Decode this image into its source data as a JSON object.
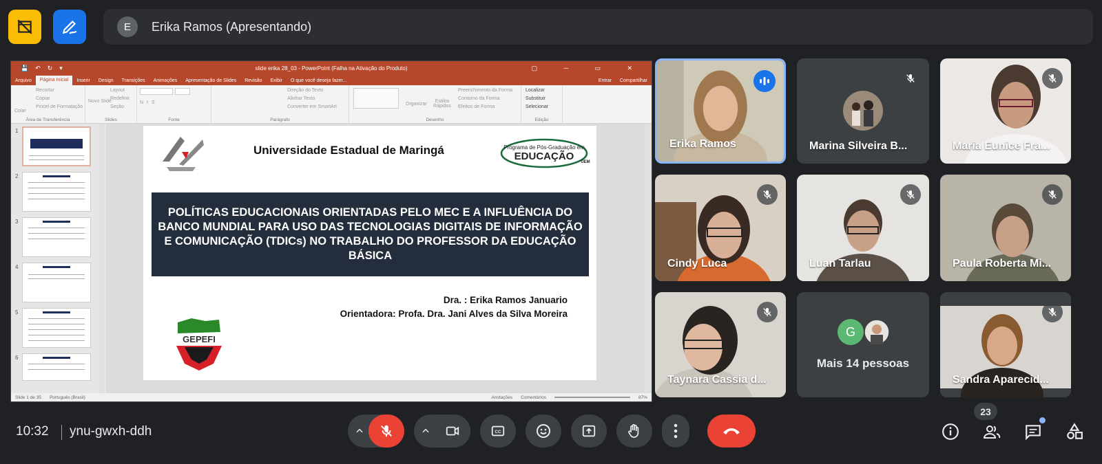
{
  "presenter": {
    "initial": "E",
    "label": "Erika Ramos (Apresentando)"
  },
  "ppt": {
    "window_title": "slide erika 28_03 - PowerPoint (Falha na Ativação do Produto)",
    "tabs": [
      "Arquivo",
      "Página Inicial",
      "Inserir",
      "Design",
      "Transições",
      "Animações",
      "Apresentação de Slides",
      "Revisão",
      "Exibir",
      "O que você deseja fazer..."
    ],
    "tabs_right": [
      "Entrar",
      "Compartilhar"
    ],
    "ribbon": {
      "clipboard": [
        "Recortar",
        "Copiar",
        "Pincel de Formatação",
        "Colar",
        "Área de Transferência"
      ],
      "slides": [
        "Layout",
        "Redefinir",
        "Seção",
        "Novo Slide",
        "Slides"
      ],
      "font_label": "Fonte",
      "paragraph": [
        "Direção do Texto",
        "Alinhar Texto",
        "Converter em SmartArt",
        "Parágrafo"
      ],
      "drawing": [
        "Organizar",
        "Estilos Rápidos",
        "Preenchimento da Forma",
        "Contorno da Forma",
        "Efeitos de Forma",
        "Desenho"
      ],
      "editing": [
        "Localizar",
        "Substituir",
        "Selecionar",
        "Edição"
      ]
    },
    "slide_numbers": [
      "1",
      "2",
      "3",
      "4",
      "5",
      "6"
    ],
    "slide": {
      "university": "Universidade Estadual de Maringá",
      "program_small": "Programa de Pós-Graduação em",
      "program_big": "EDUCAÇÃO",
      "program_tag": "UEM",
      "title": "POLÍTICAS EDUCACIONAIS ORIENTADAS PELO MEC E A INFLUÊNCIA DO BANCO MUNDIAL PARA USO DAS TECNOLOGIAS DIGITAIS DE INFORMAÇÃO E COMUNICAÇÃO (TDICs) NO TRABALHO DO PROFESSOR DA EDUCAÇÃO BÁSICA",
      "author": "Dra. : Erika Ramos Januario",
      "advisor": "Orientadora: Profa. Dra. Jani Alves da Silva Moreira",
      "gepefi": "GEPEFI"
    },
    "status": {
      "slide_count": "Slide 1 de 35",
      "language": "Português (Brasil)",
      "notes": "Anotações",
      "comments": "Comentários",
      "zoom": "87%"
    }
  },
  "participants": [
    {
      "name": "Erika Ramos",
      "state": "speaking"
    },
    {
      "name": "Marina Silveira B...",
      "state": "muted"
    },
    {
      "name": "Maria Eunice Fra...",
      "state": "muted"
    },
    {
      "name": "Cindy Luca",
      "state": "muted"
    },
    {
      "name": "Luan Tarlau",
      "state": "muted"
    },
    {
      "name": "Paula Roberta Mi...",
      "state": "muted"
    },
    {
      "name": "Taynara Cassia d...",
      "state": "muted"
    },
    {
      "name": "Mais 14 pessoas",
      "initial": "G"
    },
    {
      "name": "Sandra Aparecid...",
      "state": "muted"
    }
  ],
  "meeting": {
    "time": "10:32",
    "code": "ynu-gwxh-ddh",
    "participant_count": "23"
  },
  "colors": {
    "leave": "#ea4335",
    "accent": "#8ab4f8",
    "ppt": "#b7472a"
  }
}
